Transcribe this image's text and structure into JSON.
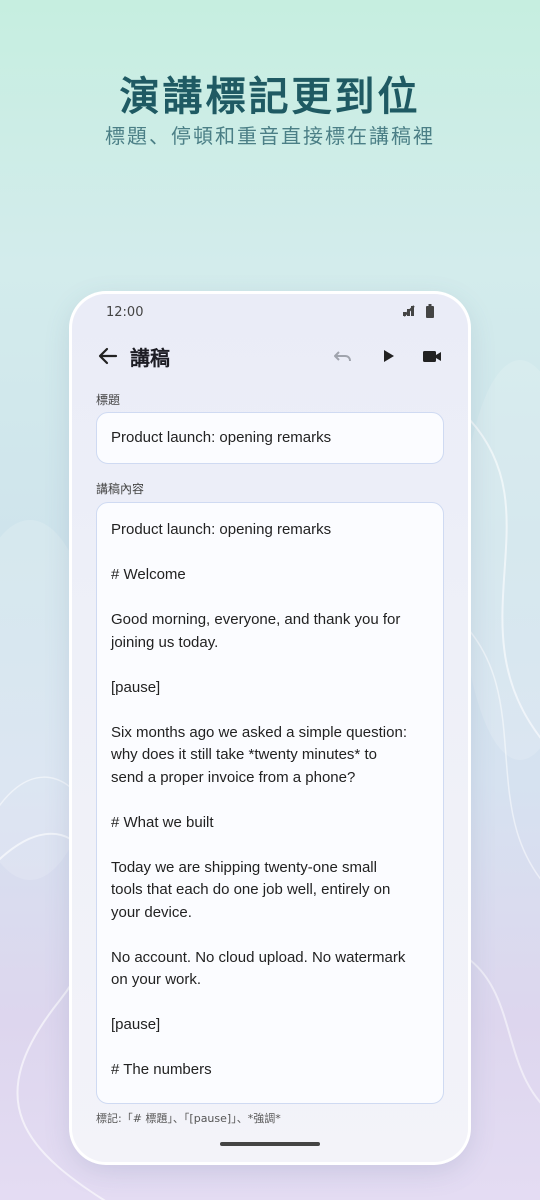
{
  "promo": {
    "headline": "演講標記更到位",
    "subline": "標題、停頓和重音直接標在講稿裡"
  },
  "status_bar": {
    "time": "12:00",
    "icons": [
      "signal-off-icon",
      "battery-icon"
    ]
  },
  "app_bar": {
    "title": "講稿",
    "actions": [
      "undo-icon",
      "play-icon",
      "video-camera-icon"
    ]
  },
  "title_field": {
    "label": "標題",
    "value": "Product launch: opening remarks"
  },
  "content_field": {
    "label": "講稿內容",
    "lines": [
      "Product launch: opening remarks",
      "",
      "# Welcome",
      "",
      "Good morning, everyone, and thank you for",
      "joining us today.",
      "",
      "[pause]",
      "",
      "Six months ago we asked a simple question:",
      "why does it still take *twenty minutes* to",
      "send a proper invoice from a phone?",
      "",
      "# What we built",
      "",
      "Today we are shipping twenty-one small",
      "tools that each do one job well, entirely on",
      "your device.",
      "",
      "No account. No cloud upload. No watermark",
      "on your work.",
      "",
      "[pause]",
      "",
      "# The numbers"
    ]
  },
  "hint": "標記:「# 標題」、「[pause]」、*強調*",
  "colors": {
    "headline": "#1f5a63",
    "field_border": "#cfdaf2"
  }
}
